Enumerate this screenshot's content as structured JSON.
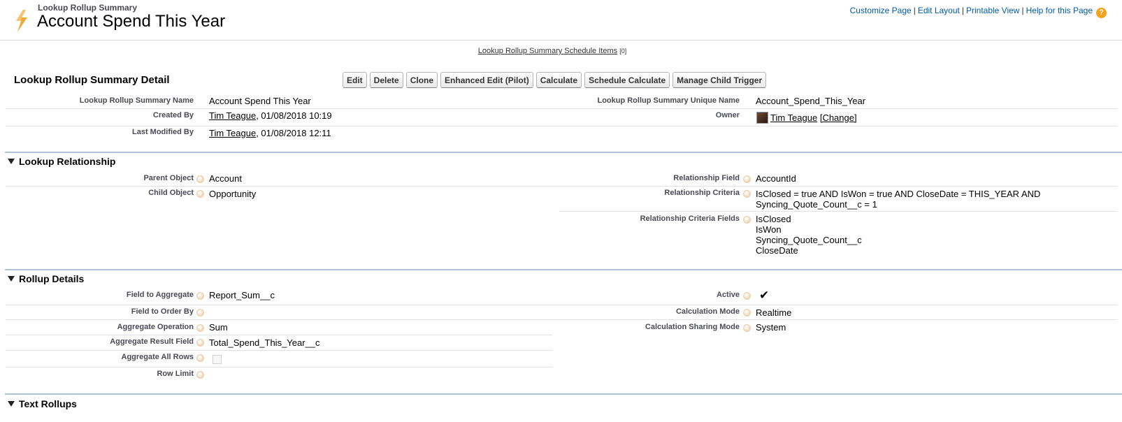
{
  "header": {
    "subtitle": "Lookup Rollup Summary",
    "title": "Account Spend This Year",
    "links": [
      "Customize Page",
      "Edit Layout",
      "Printable View",
      "Help for this Page"
    ],
    "help_icon_glyph": "?"
  },
  "related": {
    "link_label": "Lookup Rollup Summary Schedule Items",
    "count": "[0]"
  },
  "detail": {
    "title": "Lookup Rollup Summary Detail",
    "buttons": [
      "Edit",
      "Delete",
      "Clone",
      "Enhanced Edit (Pilot)",
      "Calculate",
      "Schedule Calculate",
      "Manage Child Trigger"
    ],
    "name_label": "Lookup Rollup Summary Name",
    "name_value": "Account Spend This Year",
    "unique_label": "Lookup Rollup Summary Unique Name",
    "unique_value": "Account_Spend_This_Year",
    "created_label": "Created By",
    "created_user": "Tim Teague",
    "created_date": ", 01/08/2018 10:19",
    "owner_label": "Owner",
    "owner_user": "Tim Teague",
    "owner_change": "[Change]",
    "modified_label": "Last Modified By",
    "modified_user": "Tim Teague",
    "modified_date": ", 01/08/2018 12:11"
  },
  "lookup": {
    "header": "Lookup Relationship",
    "parent_label": "Parent Object",
    "parent_value": "Account",
    "child_label": "Child Object",
    "child_value": "Opportunity",
    "relfield_label": "Relationship Field",
    "relfield_value": "AccountId",
    "criteria_label": "Relationship Criteria",
    "criteria_line1": "IsClosed = true AND IsWon = true AND CloseDate = THIS_YEAR AND",
    "criteria_line2": "Syncing_Quote_Count__c = 1",
    "criteria_fields_label": "Relationship Criteria Fields",
    "criteria_fields": [
      "IsClosed",
      "IsWon",
      "Syncing_Quote_Count__c",
      "CloseDate"
    ]
  },
  "rollup": {
    "header": "Rollup Details",
    "aggregate_field_label": "Field to Aggregate",
    "aggregate_field_value": "Report_Sum__c",
    "order_by_label": "Field to Order By",
    "operation_label": "Aggregate Operation",
    "operation_value": "Sum",
    "result_field_label": "Aggregate Result Field",
    "result_field_value": "Total_Spend_This_Year__c",
    "all_rows_label": "Aggregate All Rows",
    "row_limit_label": "Row Limit",
    "active_label": "Active",
    "active_mark": "✔",
    "calc_mode_label": "Calculation Mode",
    "calc_mode_value": "Realtime",
    "sharing_label": "Calculation Sharing Mode",
    "sharing_value": "System"
  },
  "text_rollups": {
    "header": "Text Rollups"
  },
  "colors": {
    "link": "#015ba7",
    "label": "#4a4a56",
    "section_rule": "#b0c4d8",
    "help_orange": "#f3a21b"
  }
}
